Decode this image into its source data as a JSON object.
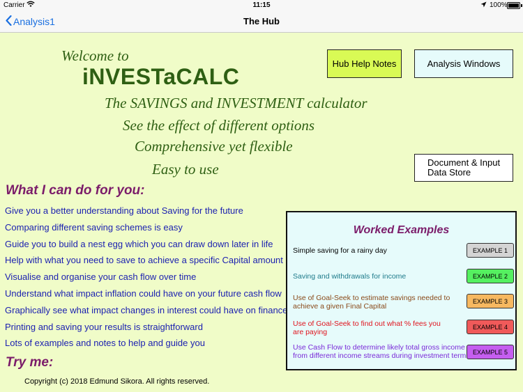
{
  "status": {
    "carrier": "Carrier",
    "time": "11:15",
    "battery": "100%"
  },
  "nav": {
    "back_label": "Analysis1",
    "title": "The Hub"
  },
  "hero": {
    "welcome": "Welcome to",
    "brand": "iNVESTaCALC",
    "taglines": [
      "The SAVINGS and INVESTMENT calculator",
      "See the effect of different options",
      "Comprehensive yet flexible",
      "Easy to use"
    ]
  },
  "buttons": {
    "hub_help_notes": "Hub Help Notes",
    "analysis_windows": "Analysis Windows",
    "doc_store_line1": "Document & Input",
    "doc_store_line2": "Data Store"
  },
  "can_do": {
    "heading": "What I can do for you:",
    "items": [
      "Give you a better understanding about Saving for the future",
      "Comparing different saving schemes is easy",
      "Guide you to build a nest egg which you can draw down later in life",
      "Help with what you need to save to achieve a specific Capital amount",
      "Visualise and organise your cash flow over time",
      "Understand what impact inflation could have on your future cash flow",
      "Graphically see what impact changes in interest could have on finances",
      "Printing and saving your results is straightforward",
      "Lots of examples and notes to help and guide you"
    ]
  },
  "try_me": "Try me:",
  "copyright": "Copyright (c) 2018 Edmund Sikora. All rights reserved.",
  "worked": {
    "title": "Worked Examples",
    "examples": [
      {
        "text1": "Simple saving for a rainy day",
        "text2": "",
        "button": "EXAMPLE 1",
        "text_color": "#000000",
        "button_color": "#d4d4d4"
      },
      {
        "text1": "Saving and withdrawals for income",
        "text2": "",
        "button": "EXAMPLE 2",
        "text_color": "#1d7a8a",
        "button_color": "#55f060"
      },
      {
        "text1": "Use of Goal-Seek to estimate savings needed to",
        "text2": "achieve a given Final Capital",
        "button": "EXAMPLE 3",
        "text_color": "#8a4a1a",
        "button_color": "#f7b860"
      },
      {
        "text1": "Use of Goal-Seek to find out what % fees you",
        "text2": "are paying",
        "button": "EXAMPLE 4",
        "text_color": "#e0141e",
        "button_color": "#f05a5a"
      },
      {
        "text1": "Use Cash Flow to determine likely total gross income",
        "text2": "from different income streams during investment term",
        "button": "EXAMPLE 5",
        "text_color": "#7a2ad8",
        "button_color": "#c55ef0"
      }
    ]
  }
}
